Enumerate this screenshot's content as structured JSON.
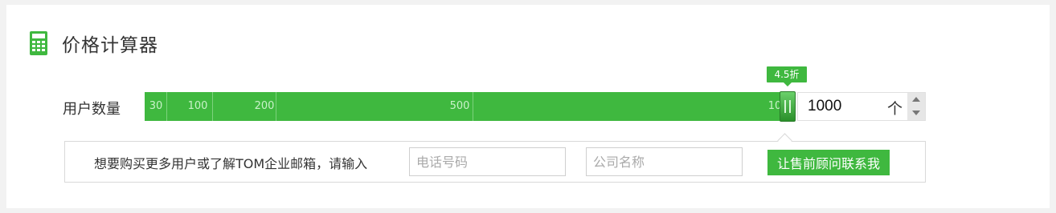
{
  "calculator": {
    "title": "价格计算器",
    "icon": "calculator-icon",
    "accent_color": "#3fb83f"
  },
  "users": {
    "label": "用户数量",
    "ticks": [
      "30",
      "100",
      "200",
      "500",
      "10"
    ],
    "discount_badge": "4.5折",
    "quantity_value": "1000",
    "unit": "个"
  },
  "contact": {
    "prompt": "想要购买更多用户或了解TOM企业邮箱，请输入",
    "phone_placeholder": "电话号码",
    "company_placeholder": "公司名称",
    "button_label": "让售前顾问联系我"
  }
}
